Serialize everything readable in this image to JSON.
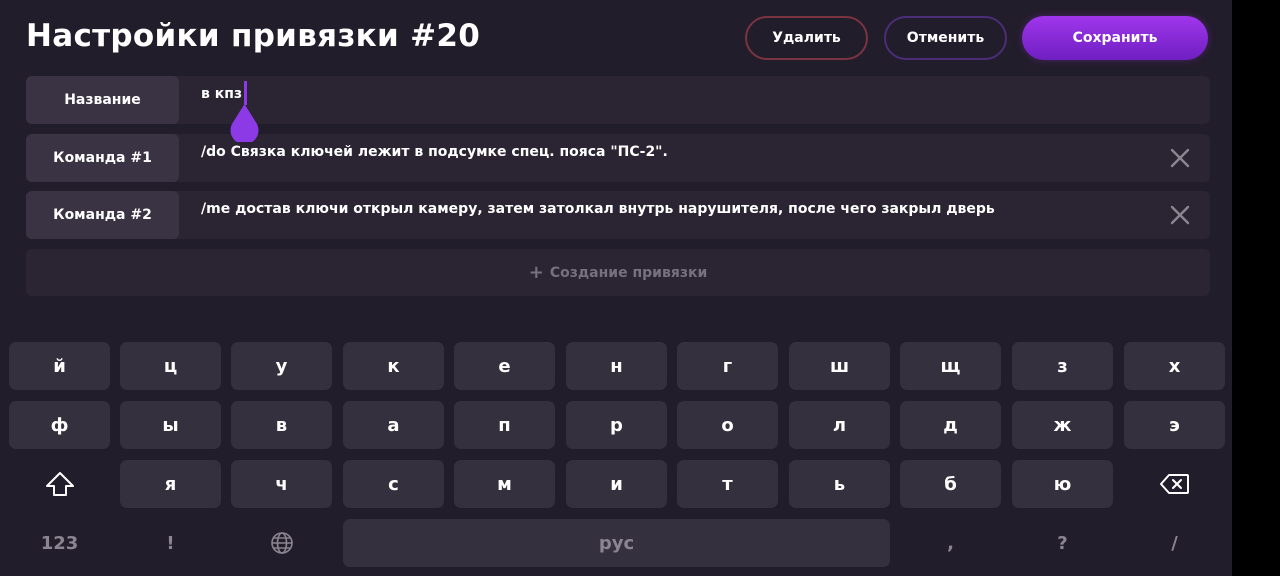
{
  "header": {
    "title": "Настройки привязки #20",
    "delete_label": "Удалить",
    "cancel_label": "Отменить",
    "save_label": "Сохранить"
  },
  "fields": {
    "name_label": "Название",
    "name_value": "в кпз",
    "commands": [
      {
        "label": "Команда #1",
        "value": "/do Связка ключей лежит в подсумке спец. пояса \"ПС-2\"."
      },
      {
        "label": "Команда #2",
        "value": "/me достав ключи открыл камеру, затем затолкал внутрь нарушителя, после чего закрыл дверь"
      }
    ]
  },
  "add_binding_label": "Создание привязки",
  "keyboard": {
    "row1": [
      "й",
      "ц",
      "у",
      "к",
      "е",
      "н",
      "г",
      "ш",
      "щ",
      "з",
      "х"
    ],
    "row2": [
      "ф",
      "ы",
      "в",
      "а",
      "п",
      "р",
      "о",
      "л",
      "д",
      "ж",
      "э"
    ],
    "row3": [
      "я",
      "ч",
      "с",
      "м",
      "и",
      "т",
      "ь",
      "б",
      "ю"
    ],
    "numbers_label": "123",
    "exclamation": "!",
    "space_label": "рус",
    "comma": ",",
    "question": "?",
    "slash": "/"
  },
  "colors": {
    "background": "#221d2a",
    "accent": "#8b3ae6",
    "key": "#35303d"
  }
}
